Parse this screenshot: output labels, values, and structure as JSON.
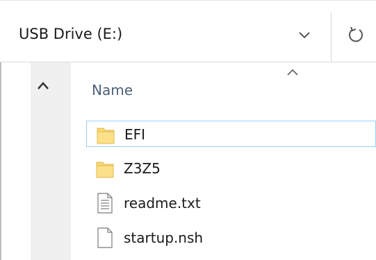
{
  "address_bar": {
    "path": "USB Drive (E:)",
    "dropdown_icon": "chevron-down-icon",
    "refresh_icon": "refresh-icon"
  },
  "navigation_pane": {
    "scroll_up_icon": "chevron-up-icon"
  },
  "file_list": {
    "columns": [
      {
        "label": "Name",
        "sorted": "ascending"
      }
    ],
    "items": [
      {
        "name": "EFI",
        "type": "folder",
        "icon": "folder-icon",
        "selected": true
      },
      {
        "name": "Z3Z5",
        "type": "folder",
        "icon": "folder-icon",
        "selected": false
      },
      {
        "name": "readme.txt",
        "type": "text-file",
        "icon": "text-document-icon",
        "selected": false
      },
      {
        "name": "startup.nsh",
        "type": "file",
        "icon": "blank-document-icon",
        "selected": false
      }
    ]
  },
  "colors": {
    "selection_border": "#99d1ff",
    "folder_yellow": "#f8d775",
    "header_text": "#4c607a"
  }
}
